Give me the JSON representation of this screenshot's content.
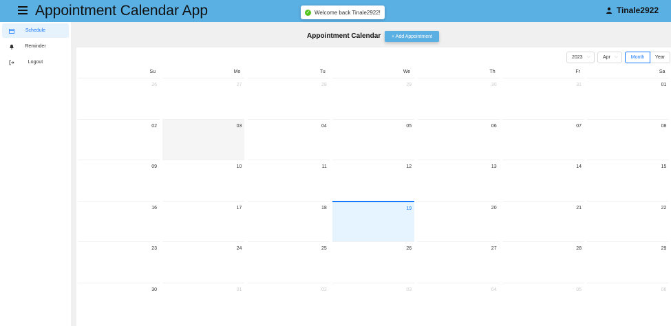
{
  "header": {
    "title": "Appointment Calendar App",
    "toast": "Welcome back Tinale2922!",
    "username": "Tinale2922"
  },
  "sidebar": {
    "items": [
      {
        "label": "Schedule",
        "icon": "calendar-icon",
        "active": true
      },
      {
        "label": "Reminder",
        "icon": "bell-icon",
        "active": false
      },
      {
        "label": "Logout",
        "icon": "logout-icon",
        "active": false
      }
    ]
  },
  "main": {
    "title": "Appointment Calendar",
    "add_button": "+ Add Appointment"
  },
  "calendar": {
    "year": "2023",
    "month": "Apr",
    "mode_month": "Month",
    "mode_year": "Year",
    "weekdays": [
      "Su",
      "Mo",
      "Tu",
      "We",
      "Th",
      "Fr",
      "Sa"
    ],
    "days": [
      [
        "26",
        "27",
        "28",
        "29",
        "30",
        "31",
        "01"
      ],
      [
        "02",
        "03",
        "04",
        "05",
        "06",
        "07",
        "08"
      ],
      [
        "09",
        "10",
        "11",
        "12",
        "13",
        "14",
        "15"
      ],
      [
        "16",
        "17",
        "18",
        "19",
        "20",
        "21",
        "22"
      ],
      [
        "23",
        "24",
        "25",
        "26",
        "27",
        "28",
        "29"
      ],
      [
        "30",
        "01",
        "02",
        "03",
        "04",
        "05",
        "06"
      ]
    ],
    "other_month": [
      [
        true,
        true,
        true,
        true,
        true,
        true,
        false
      ],
      [
        false,
        false,
        false,
        false,
        false,
        false,
        false
      ],
      [
        false,
        false,
        false,
        false,
        false,
        false,
        false
      ],
      [
        false,
        false,
        false,
        false,
        false,
        false,
        false
      ],
      [
        false,
        false,
        false,
        false,
        false,
        false,
        false
      ],
      [
        false,
        true,
        true,
        true,
        true,
        true,
        true
      ]
    ],
    "selected_day": "03",
    "today_day": "19"
  },
  "colors": {
    "header_bg": "#5aafe3",
    "accent": "#1677ff",
    "today_bg": "#e6f4ff",
    "toast_success": "#52c41a"
  }
}
